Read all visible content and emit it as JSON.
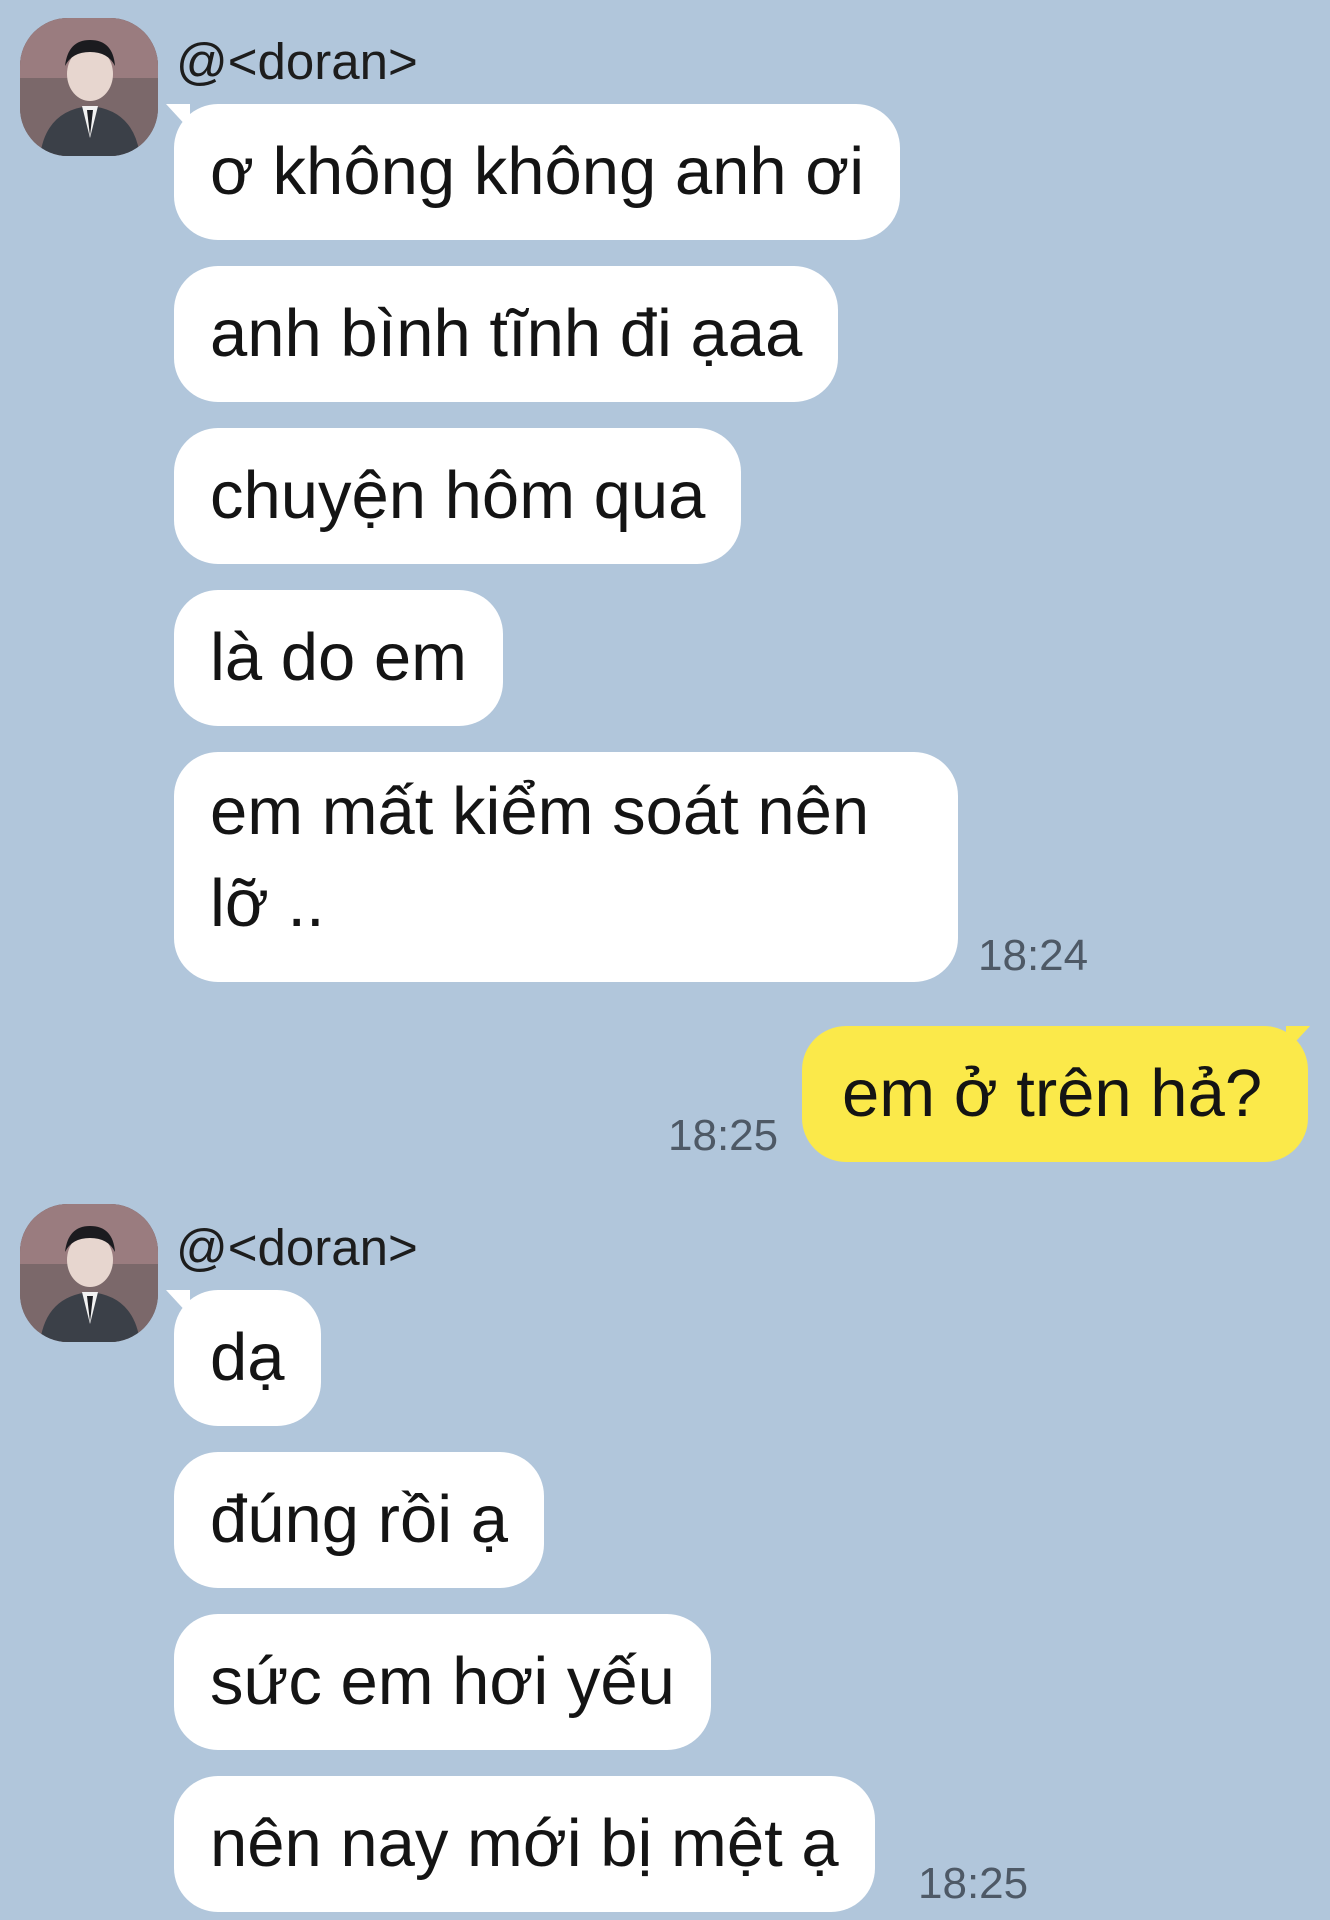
{
  "conversation": {
    "groups": [
      {
        "sender": "@<doran>",
        "messages": [
          "ơ không không anh ơi",
          "anh bình tĩnh đi ạaa",
          "chuyện hôm qua",
          "là do em",
          "em mất kiểm soát nên lỡ .."
        ],
        "time": "18:24"
      },
      {
        "sender": "me",
        "messages": [
          "em ở trên hả?"
        ],
        "time": "18:25"
      },
      {
        "sender": "@<doran>",
        "messages": [
          "dạ",
          "đúng rồi ạ",
          "sức em hơi yếu",
          "nên nay mới bị mệt ạ"
        ],
        "time": "18:25"
      }
    ]
  },
  "colors": {
    "background": "#b1c6db",
    "incoming_bubble": "#ffffff",
    "outgoing_bubble": "#fbe94a"
  },
  "icons": {
    "avatar": "profile-photo-avatar"
  }
}
